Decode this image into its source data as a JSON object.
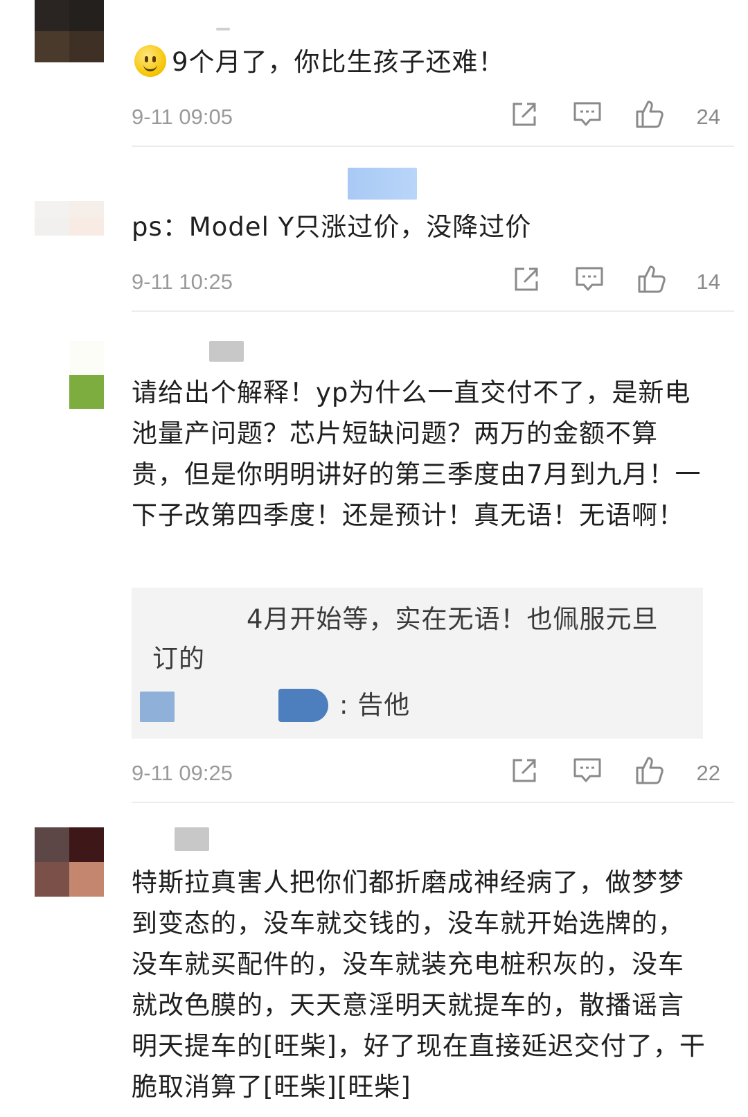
{
  "comments": [
    {
      "text": "9个月了，你比生孩子还难！",
      "time": "9-11 09:05",
      "likes": "24",
      "avatar_colors": [
        "#2a2522",
        "#24201d",
        "#4a3a2c",
        "#3e3024"
      ]
    },
    {
      "text": "ps：Model Y只涨过价，没降过价",
      "time": "9-11 10:25",
      "likes": "14",
      "avatar_colors": [
        "#f4f2f0",
        "#f6eee8",
        "#f2f0ee",
        "#f7ebe4"
      ]
    },
    {
      "text": "请给出个解释！yp为什么一直交付不了，是新电池量产问题？芯片短缺问题？两万的金额不算贵，但是你明明讲好的第三季度由7月到九月！一下子改第四季度！还是预计！真无语！无语啊！",
      "time": "9-11 09:25",
      "likes": "22",
      "reply": {
        "line1": "4月开始等，实在无语！也佩服元旦",
        "line2": "订的",
        "line3": ": 告他"
      },
      "avatar_colors": [
        "#ffffff",
        "#fdfdf8",
        "#ffffff",
        "#7cad3e"
      ]
    },
    {
      "text": "特斯拉真害人把你们都折磨成神经病了，做梦梦到变态的，没车就交钱的，没车就开始选牌的，没车就买配件的，没车就装充电桩积灰的，没车就改色膜的，天天意淫明天就提车的，散播谣言明天提车的[旺柴]，好了现在直接延迟交付了，干脆取消算了[旺柴][旺柴]",
      "avatar_colors": [
        "#5c4646",
        "#3e1718",
        "#7a5048",
        "#c58670"
      ]
    }
  ],
  "icons": {
    "share": "share-icon",
    "comment": "comment-icon",
    "like": "thumbs-up-icon"
  },
  "colors": {
    "text": "#1f1f1f",
    "meta": "#9a9a9a",
    "reply_bg": "#f3f3f3",
    "mask_blue": "#a9c9f5",
    "mask_gray": "#c8c8c8",
    "mask_dark_blue": "#4d7fbf"
  }
}
